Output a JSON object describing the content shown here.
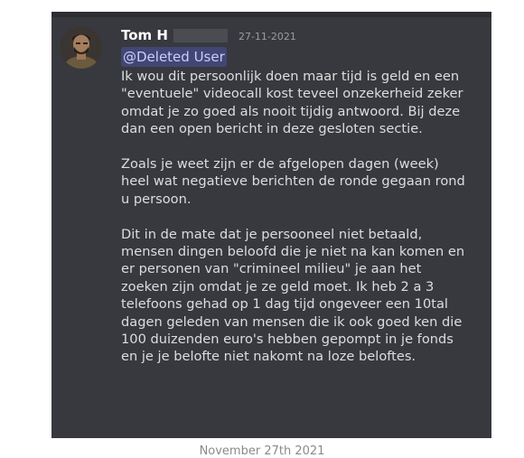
{
  "message": {
    "username": "Tom H",
    "timestamp": "27-11-2021",
    "mention": "@Deleted User",
    "avatar_icon": "user-avatar-photo",
    "paragraphs": [
      {
        "lines": [
          "Ik wou dit persoonlijk doen maar tijd is geld en een",
          "\"eventuele\" videocall kost teveel onzekerheid zeker",
          "omdat je zo goed als nooit tijdig antwoord. Bij deze",
          "dan een open bericht in deze gesloten sectie."
        ]
      },
      {
        "lines": [
          "Zoals je weet zijn er de afgelopen dagen (week)",
          "heel wat negatieve berichten de ronde gegaan rond",
          "u persoon."
        ]
      },
      {
        "lines": [
          "Dit in de mate dat je persooneel niet betaald,",
          "mensen dingen beloofd die je niet na kan komen en",
          "er personen van \"crimineel milieu\"  je aan het",
          "zoeken zijn omdat je ze geld moet. Ik heb 2 a 3",
          "telefoons gehad op 1 dag tijd ongeveer een 10tal",
          "dagen geleden van mensen die ik ook goed ken die",
          "100 duizenden euro's  hebben gepompt in je fonds",
          "en je je belofte niet nakomt na loze beloftes."
        ]
      }
    ]
  },
  "caption": "November 27th 2021",
  "colors": {
    "message_bg": "#37393e",
    "text": "#dcddde",
    "mention_bg": "#414675",
    "mention_text": "#c9cdfb",
    "timestamp": "#9a9ca2"
  }
}
